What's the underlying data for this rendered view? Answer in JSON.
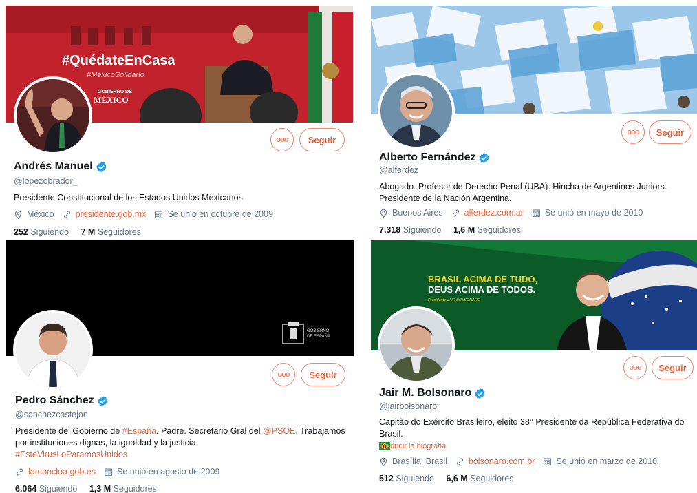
{
  "colors": {
    "accent": "#e8663f",
    "verified": "#1da1f2",
    "muted": "#657786"
  },
  "profiles": [
    {
      "name": "Andrés Manuel",
      "handle": "@lopezobrador_",
      "bio": "Presidente Constitucional de los Estados Unidos Mexicanos",
      "location": "México",
      "website": "presidente.gob.mx",
      "joined": "Se unió en octubre de 2009",
      "following_count": "252",
      "following_label": "Siguiendo",
      "followers_count": "7 M",
      "followers_label": "Seguidores",
      "more_label": "ooo",
      "follow_label": "Seguir",
      "banner_text": "#QuédateEnCasa",
      "banner_subtext": "#MéxicoSolidario",
      "banner_brand_line1": "GOBIERNO DE",
      "banner_brand_line2": "MÉXICO"
    },
    {
      "name": "Alberto Fernández",
      "handle": "@alferdez",
      "bio": "Abogado. Profesor de Derecho Penal (UBA). Hincha de Argentinos Juniors. Presidente de la Nación Argentina.",
      "location": "Buenos Aires",
      "website": "alferdez.com.ar",
      "joined": "Se unió en mayo de 2010",
      "following_count": "7.318",
      "following_label": "Siguiendo",
      "followers_count": "1,6 M",
      "followers_label": "Seguidores",
      "more_label": "ooo",
      "follow_label": "Seguir"
    },
    {
      "name": "Pedro Sánchez",
      "handle": "@sanchezcastejon",
      "bio_parts": [
        "Presidente del Gobierno de ",
        "#España",
        ". Padre. Secretario Gral del ",
        "@PSOE",
        ". Trabajamos por instituciones dignas, la igualdad y la justicia. "
      ],
      "bio_tag": "#EsteVirusLoParamosUnidos",
      "website": "lamoncloa.gob.es",
      "joined": "Se unió en agosto de 2009",
      "following_count": "6.064",
      "following_label": "Siguiendo",
      "followers_count": "1,3 M",
      "followers_label": "Seguidores",
      "more_label": "ooo",
      "follow_label": "Seguir",
      "banner_brand_line1": "GOBIERNO",
      "banner_brand_line2": "DE ESPAÑA"
    },
    {
      "name": "Jair M. Bolsonaro",
      "handle": "@jairbolsonaro",
      "bio": "Capitão do Exército Brasileiro, eleito 38° Presidente da República Federativa do Brasil.",
      "translate": "Traducir la biografía",
      "location": "Brasília, Brasil",
      "website": "bolsonaro.com.br",
      "joined": "Se unió en marzo de 2010",
      "following_count": "512",
      "following_label": "Siguiendo",
      "followers_count": "6,6 M",
      "followers_label": "Seguidores",
      "more_label": "ooo",
      "follow_label": "Seguir",
      "banner_line1": "BRASIL ACIMA DE TUDO,",
      "banner_line2": "DEUS ACIMA DE TODOS.",
      "banner_line3": "Presidente JAIR BOLSONARO",
      "banner_flag_text": "EM E P"
    }
  ]
}
